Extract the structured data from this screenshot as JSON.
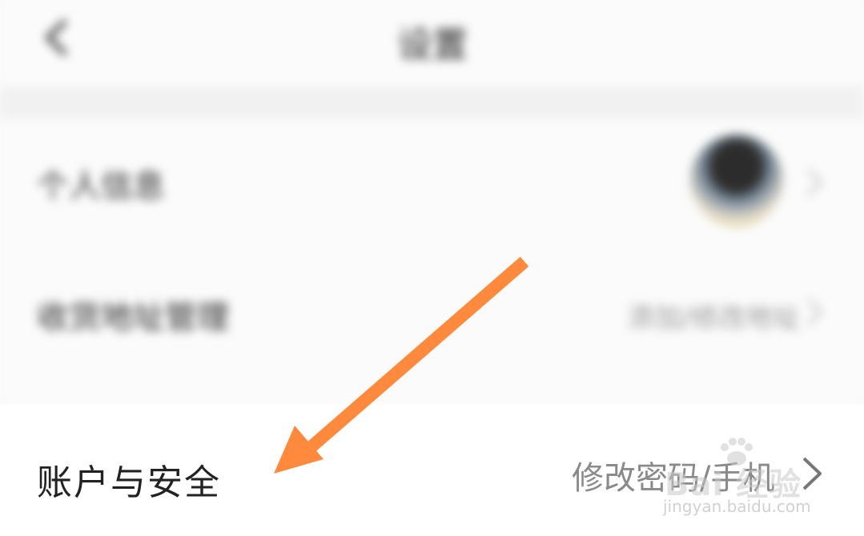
{
  "header": {
    "title": "设置",
    "back_icon": "chevron-left-icon"
  },
  "rows": {
    "profile": {
      "label": "个人信息",
      "avatar": "avatar"
    },
    "address": {
      "label": "收货地址管理",
      "value": "添加/修改地址"
    },
    "account": {
      "label": "账户与安全",
      "value": "修改密码/手机"
    }
  },
  "watermark": {
    "brand": "Bai 经验",
    "url": "jingyan.baidu.com"
  },
  "annotation": {
    "arrow_color": "#FF8A3D"
  },
  "colors": {
    "background": "#FAFAFA",
    "text_primary": "#222222",
    "text_secondary": "#8A8A8A"
  }
}
